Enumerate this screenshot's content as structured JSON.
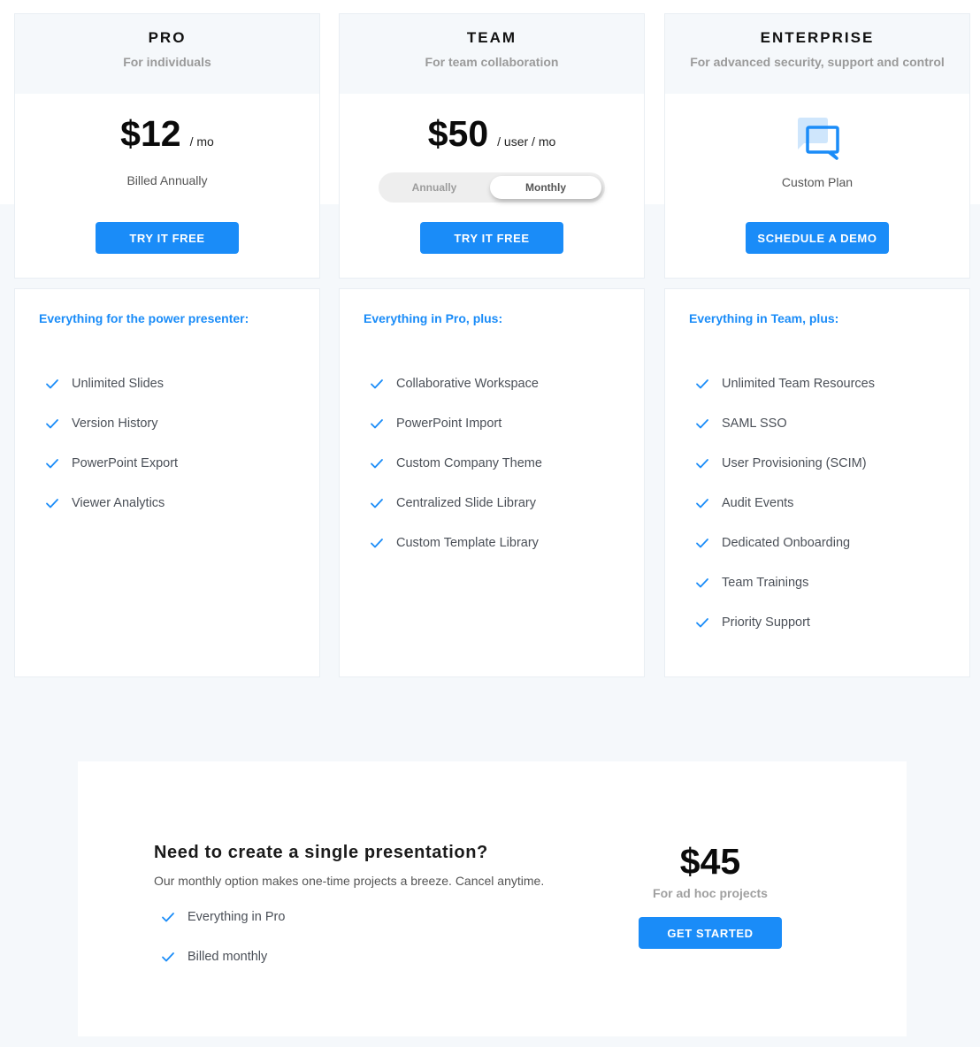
{
  "colors": {
    "accent": "#1a8cf8",
    "page_background": "#f5f8fb",
    "card_header_background": "#f5f8fb"
  },
  "plans": [
    {
      "name": "PRO",
      "subtitle": "For individuals",
      "price": "$12",
      "price_unit": "/ mo",
      "billing_note": "Billed Annually",
      "cta": "TRY IT FREE",
      "features_title": "Everything for the power presenter:",
      "features": [
        "Unlimited Slides",
        "Version History",
        "PowerPoint Export",
        "Viewer Analytics"
      ]
    },
    {
      "name": "TEAM",
      "subtitle": "For team collaboration",
      "price": "$50",
      "price_unit": "/ user / mo",
      "billing_toggle": {
        "options": [
          "Annually",
          "Monthly"
        ],
        "selected": "Monthly"
      },
      "cta": "TRY IT FREE",
      "features_title": "Everything in Pro, plus:",
      "features": [
        "Collaborative Workspace",
        "PowerPoint Import",
        "Custom Company Theme",
        "Centralized Slide Library",
        "Custom Template Library"
      ]
    },
    {
      "name": "ENTERPRISE",
      "subtitle": "For advanced security, support and control",
      "icon": "chat-bubbles-icon",
      "custom_label": "Custom Plan",
      "cta": "SCHEDULE A DEMO",
      "features_title": "Everything in Team, plus:",
      "features": [
        "Unlimited Team Resources",
        "SAML SSO",
        "User Provisioning (SCIM)",
        "Audit Events",
        "Dedicated Onboarding",
        "Team Trainings",
        "Priority Support"
      ]
    }
  ],
  "adhoc": {
    "title": "Need to create a single presentation?",
    "description": "Our monthly option makes one-time projects a breeze. Cancel anytime.",
    "features": [
      "Everything in Pro",
      "Billed monthly"
    ],
    "price": "$45",
    "price_subtitle": "For ad hoc projects",
    "cta": "GET STARTED"
  }
}
